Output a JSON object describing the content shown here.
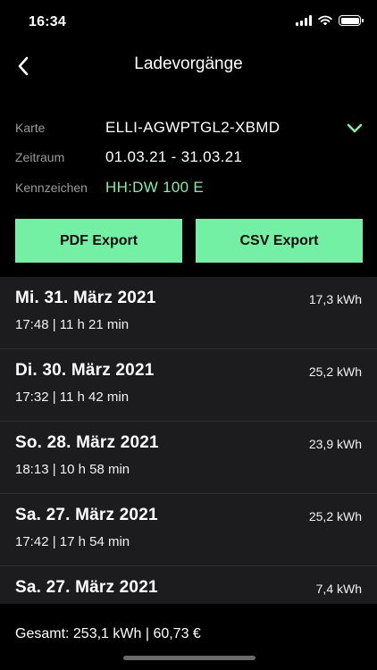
{
  "status_bar": {
    "time": "16:34",
    "icons": [
      "signal-icon",
      "wifi-icon",
      "battery-icon"
    ]
  },
  "nav": {
    "back_icon": "chevron-left-icon",
    "title": "Ladevorgänge"
  },
  "filters": {
    "card_label": "Karte",
    "card_value": "ELLI-AGWPTGL2-XBMD",
    "card_dropdown_icon": "chevron-down-icon",
    "period_label": "Zeitraum",
    "period_value": "01.03.21 - 31.03.21",
    "plate_label": "Kennzeichen",
    "plate_value": "HH:DW 100 E"
  },
  "actions": {
    "pdf_label": "PDF Export",
    "csv_label": "CSV Export"
  },
  "sessions": [
    {
      "date": "Mi. 31. März 2021",
      "detail": "17:48 | 11 h 21 min",
      "energy": "17,3 kWh"
    },
    {
      "date": "Di. 30. März 2021",
      "detail": "17:32 | 11 h 42 min",
      "energy": "25,2 kWh"
    },
    {
      "date": "So. 28. März 2021",
      "detail": "18:13 | 10 h 58 min",
      "energy": "23,9 kWh"
    },
    {
      "date": "Sa. 27. März 2021",
      "detail": "17:42 | 17 h 54 min",
      "energy": "25,2 kWh"
    },
    {
      "date": "Sa. 27. März 2021",
      "detail": "",
      "energy": "7,4 kWh"
    }
  ],
  "summary": {
    "total": "Gesamt: 253,1 kWh | 60,73 €"
  },
  "colors": {
    "background": "#000000",
    "accent": "#73f0a4",
    "accent_text": "#7ff0a9",
    "list_background": "#1c1c1e",
    "label_gray": "#9a9a9a"
  }
}
